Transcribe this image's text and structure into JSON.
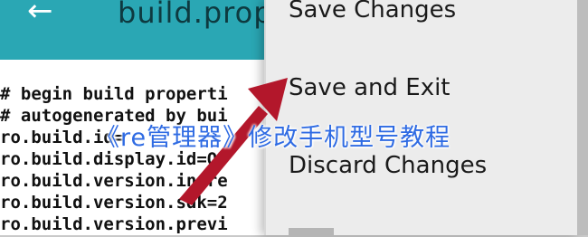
{
  "app_bar": {
    "back_icon": "arrow-left-icon",
    "title": "build.prop"
  },
  "editor": {
    "lines": [
      "# begin build properti",
      "# autogenerated by bui",
      "ro.build.id=",
      "ro.build.display.id=OP",
      "ro.build.version.incre",
      "ro.build.version.sdk=2",
      "ro.build.version.previ"
    ]
  },
  "menu": {
    "items": [
      {
        "label": "Save Changes"
      },
      {
        "label": "Save and Exit"
      },
      {
        "label": "Discard Changes"
      }
    ]
  },
  "overlay": {
    "title": "《re管理器》修改手机型号教程",
    "arrow_color": "#b3172b"
  },
  "colors": {
    "app_bar": "#2aa7b4",
    "menu_bg": "#ececec",
    "overlay_title": "#2f6be3"
  }
}
